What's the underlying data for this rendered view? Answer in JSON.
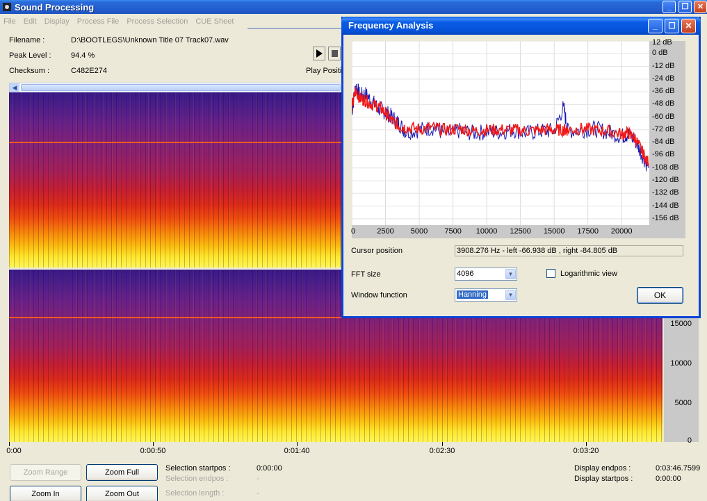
{
  "window": {
    "title": "Sound Processing"
  },
  "menu": [
    "File",
    "Edit",
    "Display",
    "Process File",
    "Process Selection",
    "CUE Sheet"
  ],
  "info": {
    "filename_label": "Filename :",
    "filename": "D:\\BOOTLEGS\\Unknown Title 07 Track07.wav",
    "peak_label": "Peak Level :",
    "peak": "94.4 %",
    "checksum_label": "Checksum :",
    "checksum": "C482E274",
    "play_position_label": "Play Positi"
  },
  "spectrogram": {
    "hz_ticks": [
      "15000",
      "10000",
      "5000",
      "0"
    ],
    "time_ticks": [
      "0:00",
      "0:00:50",
      "0:01:40",
      "0:02:30",
      "0:03:20"
    ]
  },
  "buttons": {
    "zoom_range": "Zoom Range",
    "zoom_full": "Zoom Full",
    "zoom_in": "Zoom In",
    "zoom_out": "Zoom Out"
  },
  "selection": {
    "start_label": "Selection startpos :",
    "start_value": "0:00:00",
    "end_label": "Selection endpos :",
    "end_value": "-",
    "length_label": "Selection length :",
    "length_value": "-"
  },
  "display": {
    "endpos_label": "Display endpos :",
    "endpos_value": "0:03:46.7599",
    "startpos_label": "Display startpos :",
    "startpos_value": "0:00:00"
  },
  "dialog": {
    "title": "Frequency Analysis",
    "cursor_label": "Cursor position",
    "cursor_value": "3908.276 Hz  -  left -66.938 dB , right -84.805 dB",
    "fft_label": "FFT size",
    "fft_value": "4096",
    "window_label": "Window function",
    "window_value": "Hanning",
    "log_label": "Logarithmic view",
    "log_checked": false,
    "ok_label": "OK"
  },
  "chart_data": {
    "type": "line",
    "xlabel": "",
    "ylabel": "",
    "x_ticks": [
      "0",
      "2500",
      "5000",
      "7500",
      "10000",
      "12500",
      "15000",
      "17500",
      "20000"
    ],
    "y_ticks": [
      "12 dB",
      "0 dB",
      "-12 dB",
      "-24 dB",
      "-36 dB",
      "-48 dB",
      "-60 dB",
      "-72 dB",
      "-84 dB",
      "-96 dB",
      "-108 dB",
      "-120 dB",
      "-132 dB",
      "-144 dB",
      "-156 dB"
    ],
    "xlim": [
      0,
      22050
    ],
    "ylim": [
      -162,
      12
    ],
    "grid": true,
    "series": [
      {
        "color": "#1a1ab4",
        "x": [
          0,
          300,
          600,
          1000,
          1500,
          2000,
          2500,
          3000,
          3500,
          4000,
          5000,
          6000,
          7000,
          8000,
          9000,
          10000,
          11000,
          12000,
          13000,
          14000,
          15000,
          15700,
          16000,
          17000,
          18000,
          19000,
          20000,
          20500,
          21000,
          21500,
          22000
        ],
        "y": [
          -55,
          -30,
          -40,
          -38,
          -45,
          -52,
          -55,
          -60,
          -66,
          -74,
          -72,
          -70,
          -76,
          -73,
          -75,
          -74,
          -74,
          -72,
          -75,
          -73,
          -73,
          -50,
          -73,
          -72,
          -71,
          -74,
          -78,
          -76,
          -82,
          -95,
          -108
        ]
      },
      {
        "color": "#f01818",
        "x": [
          0,
          300,
          600,
          1000,
          1500,
          2000,
          2500,
          3000,
          3500,
          4000,
          5000,
          6000,
          7000,
          8000,
          9000,
          10000,
          11000,
          12000,
          13000,
          14000,
          15000,
          15700,
          16000,
          17000,
          18000,
          19000,
          20000,
          20500,
          21000,
          21500,
          22000
        ],
        "y": [
          -50,
          -35,
          -42,
          -44,
          -48,
          -50,
          -56,
          -64,
          -68,
          -70,
          -71,
          -70,
          -72,
          -71,
          -73,
          -72,
          -72,
          -72,
          -73,
          -72,
          -72,
          -72,
          -72,
          -71,
          -72,
          -73,
          -76,
          -75,
          -80,
          -92,
          -104
        ]
      }
    ]
  }
}
